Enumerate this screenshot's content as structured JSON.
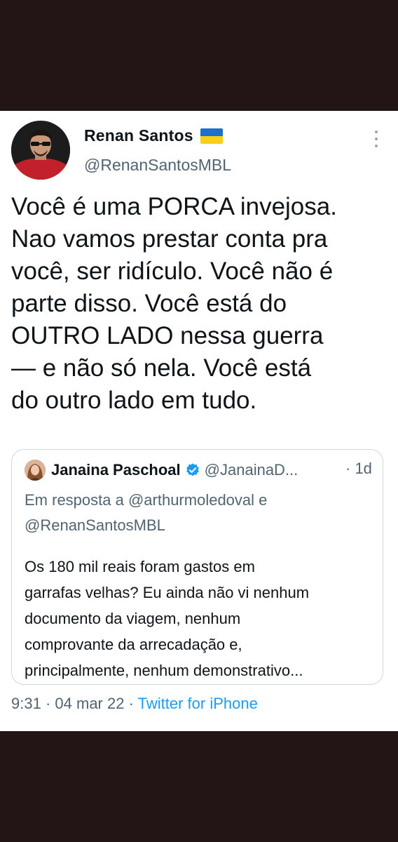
{
  "tweet": {
    "author_name": "Renan Santos",
    "author_handle": "@RenanSantosMBL",
    "flag_icon": "ukraine-flag-icon",
    "text": "Você é uma PORCA invejosa.\nNao vamos prestar conta pra\nvocê, ser ridículo. Você não é\nparte disso. Você está do\nOUTRO LADO nessa guerra\n— e não só nela. Você está\ndo outro lado em tudo.",
    "time": "9:31",
    "date": "04 mar 22",
    "source": "Twitter for iPhone",
    "separator": "·"
  },
  "quoted": {
    "author_name": "Janaina Paschoal",
    "author_handle": "@JanainaD...",
    "relative_time": "· 1d",
    "reply_context": "Em resposta a @arthurmoledoval e\n@RenanSantosMBL",
    "text": "Os 180 mil reais foram gastos em\ngarrafas velhas? Eu ainda não vi nenhum\ndocumento da viagem, nenhum\ncomprovante da arrecadação e,\nprincipalmente, nenhum demonstrativo..."
  },
  "colors": {
    "background": "#231516",
    "card": "#ffffff",
    "primary_text": "#0f1419",
    "secondary_text": "#536471",
    "link": "#1d9bf0",
    "border": "#cfd9de"
  }
}
